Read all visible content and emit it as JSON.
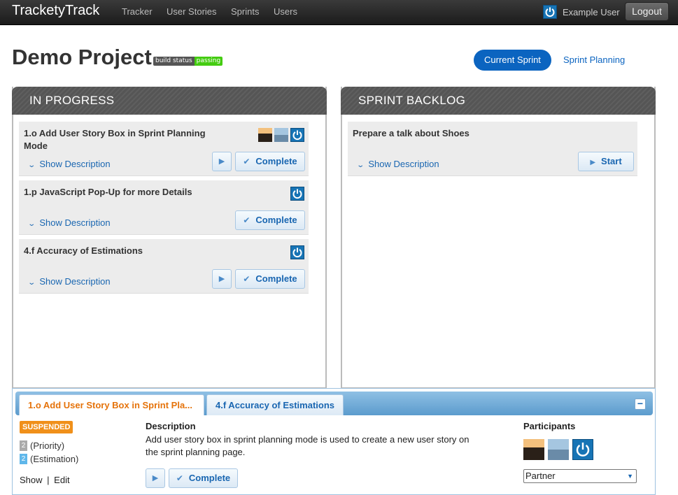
{
  "navbar": {
    "brand": "TracketyTrack",
    "links": [
      "Tracker",
      "User Stories",
      "Sprints",
      "Users"
    ],
    "user_icon": "power-icon",
    "user_name": "Example User",
    "logout": "Logout"
  },
  "header": {
    "title": "Demo Project",
    "badge_left": "build status",
    "badge_right": "passing",
    "tab_current": "Current Sprint",
    "tab_planning": "Sprint Planning"
  },
  "in_progress": {
    "title": "IN PROGRESS",
    "cards": [
      {
        "title": "1.o Add User Story Box in Sprint Planning Mode",
        "show": "Show Description",
        "complete": "Complete"
      },
      {
        "title": "1.p JavaScript Pop-Up for more Details",
        "show": "Show Description",
        "complete": "Complete"
      },
      {
        "title": "4.f Accuracy of Estimations",
        "show": "Show Description",
        "complete": "Complete"
      }
    ]
  },
  "backlog": {
    "title": "SPRINT BACKLOG",
    "cards": [
      {
        "title": "Prepare a talk about Shoes",
        "show": "Show Description",
        "start": "Start"
      }
    ]
  },
  "detail": {
    "tab_active": "1.o Add User Story Box in Sprint Pla...",
    "tab_other": "4.f Accuracy of Estimations",
    "collapse": "−",
    "status": "SUSPENDED",
    "priority_value": "2",
    "priority_label": "(Priority)",
    "estimation_value": "2",
    "estimation_label": "(Estimation)",
    "show": "Show",
    "separator": "|",
    "edit": "Edit",
    "description_heading": "Description",
    "description_text": "Add user story box in sprint planning mode is used to create a new user story on the sprint planning page.",
    "complete": "Complete",
    "participants_heading": "Participants",
    "role": "Partner"
  }
}
